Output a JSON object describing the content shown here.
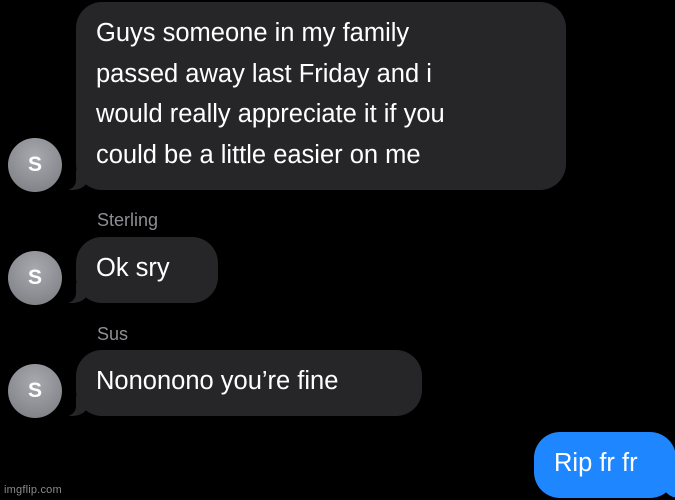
{
  "messages": [
    {
      "sender": "",
      "avatar_initial": "S",
      "direction": "incoming",
      "lines": [
        "Guys someone in my family",
        "passed away last Friday and i",
        "would really appreciate it if you",
        "could be a little easier on me"
      ]
    },
    {
      "sender": "Sterling",
      "avatar_initial": "S",
      "direction": "incoming",
      "lines": [
        "Ok sry"
      ]
    },
    {
      "sender": "Sus",
      "avatar_initial": "S",
      "direction": "incoming",
      "lines": [
        "Nononono you’re fine"
      ]
    },
    {
      "sender": "",
      "direction": "outgoing",
      "lines": [
        "Rip fr fr"
      ]
    }
  ],
  "watermark": "imgflip.com",
  "colors": {
    "background": "#000000",
    "incoming_bubble": "#262629",
    "outgoing_bubble": "#1e86ff",
    "sender_name": "#8e8e93",
    "avatar": "#8b8d93"
  }
}
